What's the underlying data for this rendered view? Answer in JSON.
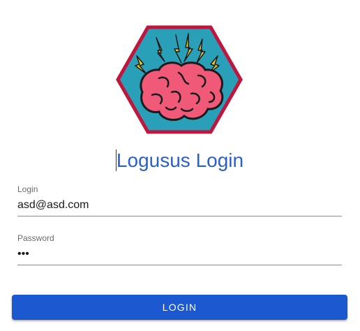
{
  "logo": {
    "icon": "brain-lightning-hexagon-logo"
  },
  "title": "Logusus Login",
  "login_field": {
    "label": "Login",
    "value": "asd@asd.com"
  },
  "password_field": {
    "label": "Password",
    "value": "•••"
  },
  "submit": {
    "label": "LOGIN"
  },
  "colors": {
    "accent": "#1c59d0",
    "title": "#2a5fcf",
    "logo_border": "#c0163e",
    "logo_bg": "#2a9fb8",
    "brain": "#f05a78",
    "bolt": "#f5d31c"
  }
}
